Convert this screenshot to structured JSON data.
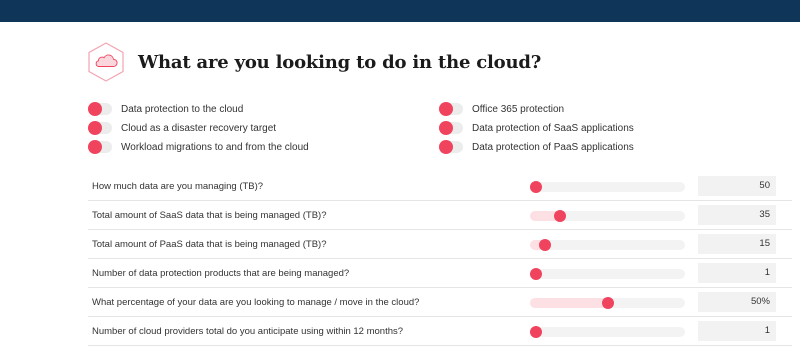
{
  "colors": {
    "topbar": "#0f3558",
    "accent": "#f0445e",
    "track": "#f3f3f3",
    "fill": "#fde0e4"
  },
  "header": {
    "icon": "cloud-hexagon-icon",
    "title": "What are you looking to do in the cloud?"
  },
  "toggles": [
    {
      "label": "Data protection to the cloud",
      "on": false
    },
    {
      "label": "Cloud as a disaster recovery target",
      "on": false
    },
    {
      "label": "Workload migrations to and from the cloud",
      "on": false
    },
    {
      "label": "Office 365 protection",
      "on": false
    },
    {
      "label": "Data protection of SaaS applications",
      "on": false
    },
    {
      "label": "Data protection of PaaS applications",
      "on": false
    }
  ],
  "sliders": [
    {
      "label": "How much data are you managing (TB)?",
      "value": "50",
      "level": 0.0
    },
    {
      "label": "Total amount of SaaS data that is being managed (TB)?",
      "value": "35",
      "level": 0.17
    },
    {
      "label": "Total amount of PaaS data that is being managed (TB)?",
      "value": "15",
      "level": 0.06
    },
    {
      "label": "Number of data protection products that are being managed?",
      "value": "1",
      "level": 0.0
    },
    {
      "label": "What percentage of your data are you looking to manage / move in the cloud?",
      "value": "50%",
      "level": 0.5
    },
    {
      "label": "Number of cloud providers total do you anticipate using within 12 months?",
      "value": "1",
      "level": 0.0
    }
  ]
}
